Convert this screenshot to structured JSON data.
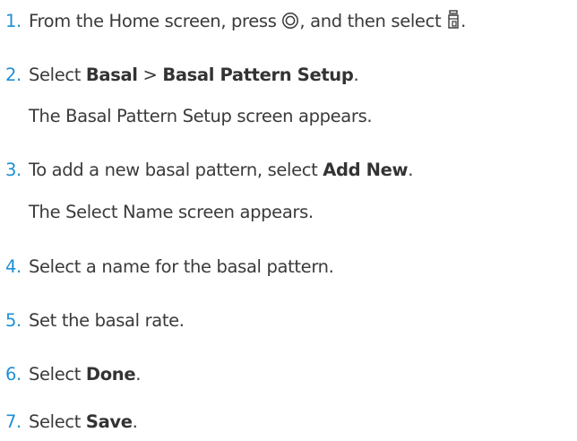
{
  "steps": [
    {
      "number": "1.",
      "text_before": "From the Home screen, press ",
      "icon_1": "menu-button-icon",
      "text_middle": ", and then select ",
      "icon_2": "reservoir-icon",
      "text_after": "."
    },
    {
      "number": "2.",
      "text_before": "Select ",
      "bold_1": "Basal",
      "text_middle": " > ",
      "bold_2": "Basal Pattern Setup",
      "text_after": ".",
      "note": "The Basal Pattern Setup screen appears."
    },
    {
      "number": "3.",
      "text_before": "To add a new basal pattern, select ",
      "bold_1": "Add New",
      "text_after": ".",
      "note": "The Select Name screen appears."
    },
    {
      "number": "4.",
      "text": "Select a name for the basal pattern."
    },
    {
      "number": "5.",
      "text": "Set the basal rate."
    },
    {
      "number": "6.",
      "text_before": "Select ",
      "bold_1": "Done",
      "text_after": "."
    },
    {
      "number": "7.",
      "text_before": "Select ",
      "bold_1": "Save",
      "text_after": "."
    }
  ],
  "colors": {
    "step_number": "#1f8fd6",
    "body_text": "#3a3a3a"
  }
}
